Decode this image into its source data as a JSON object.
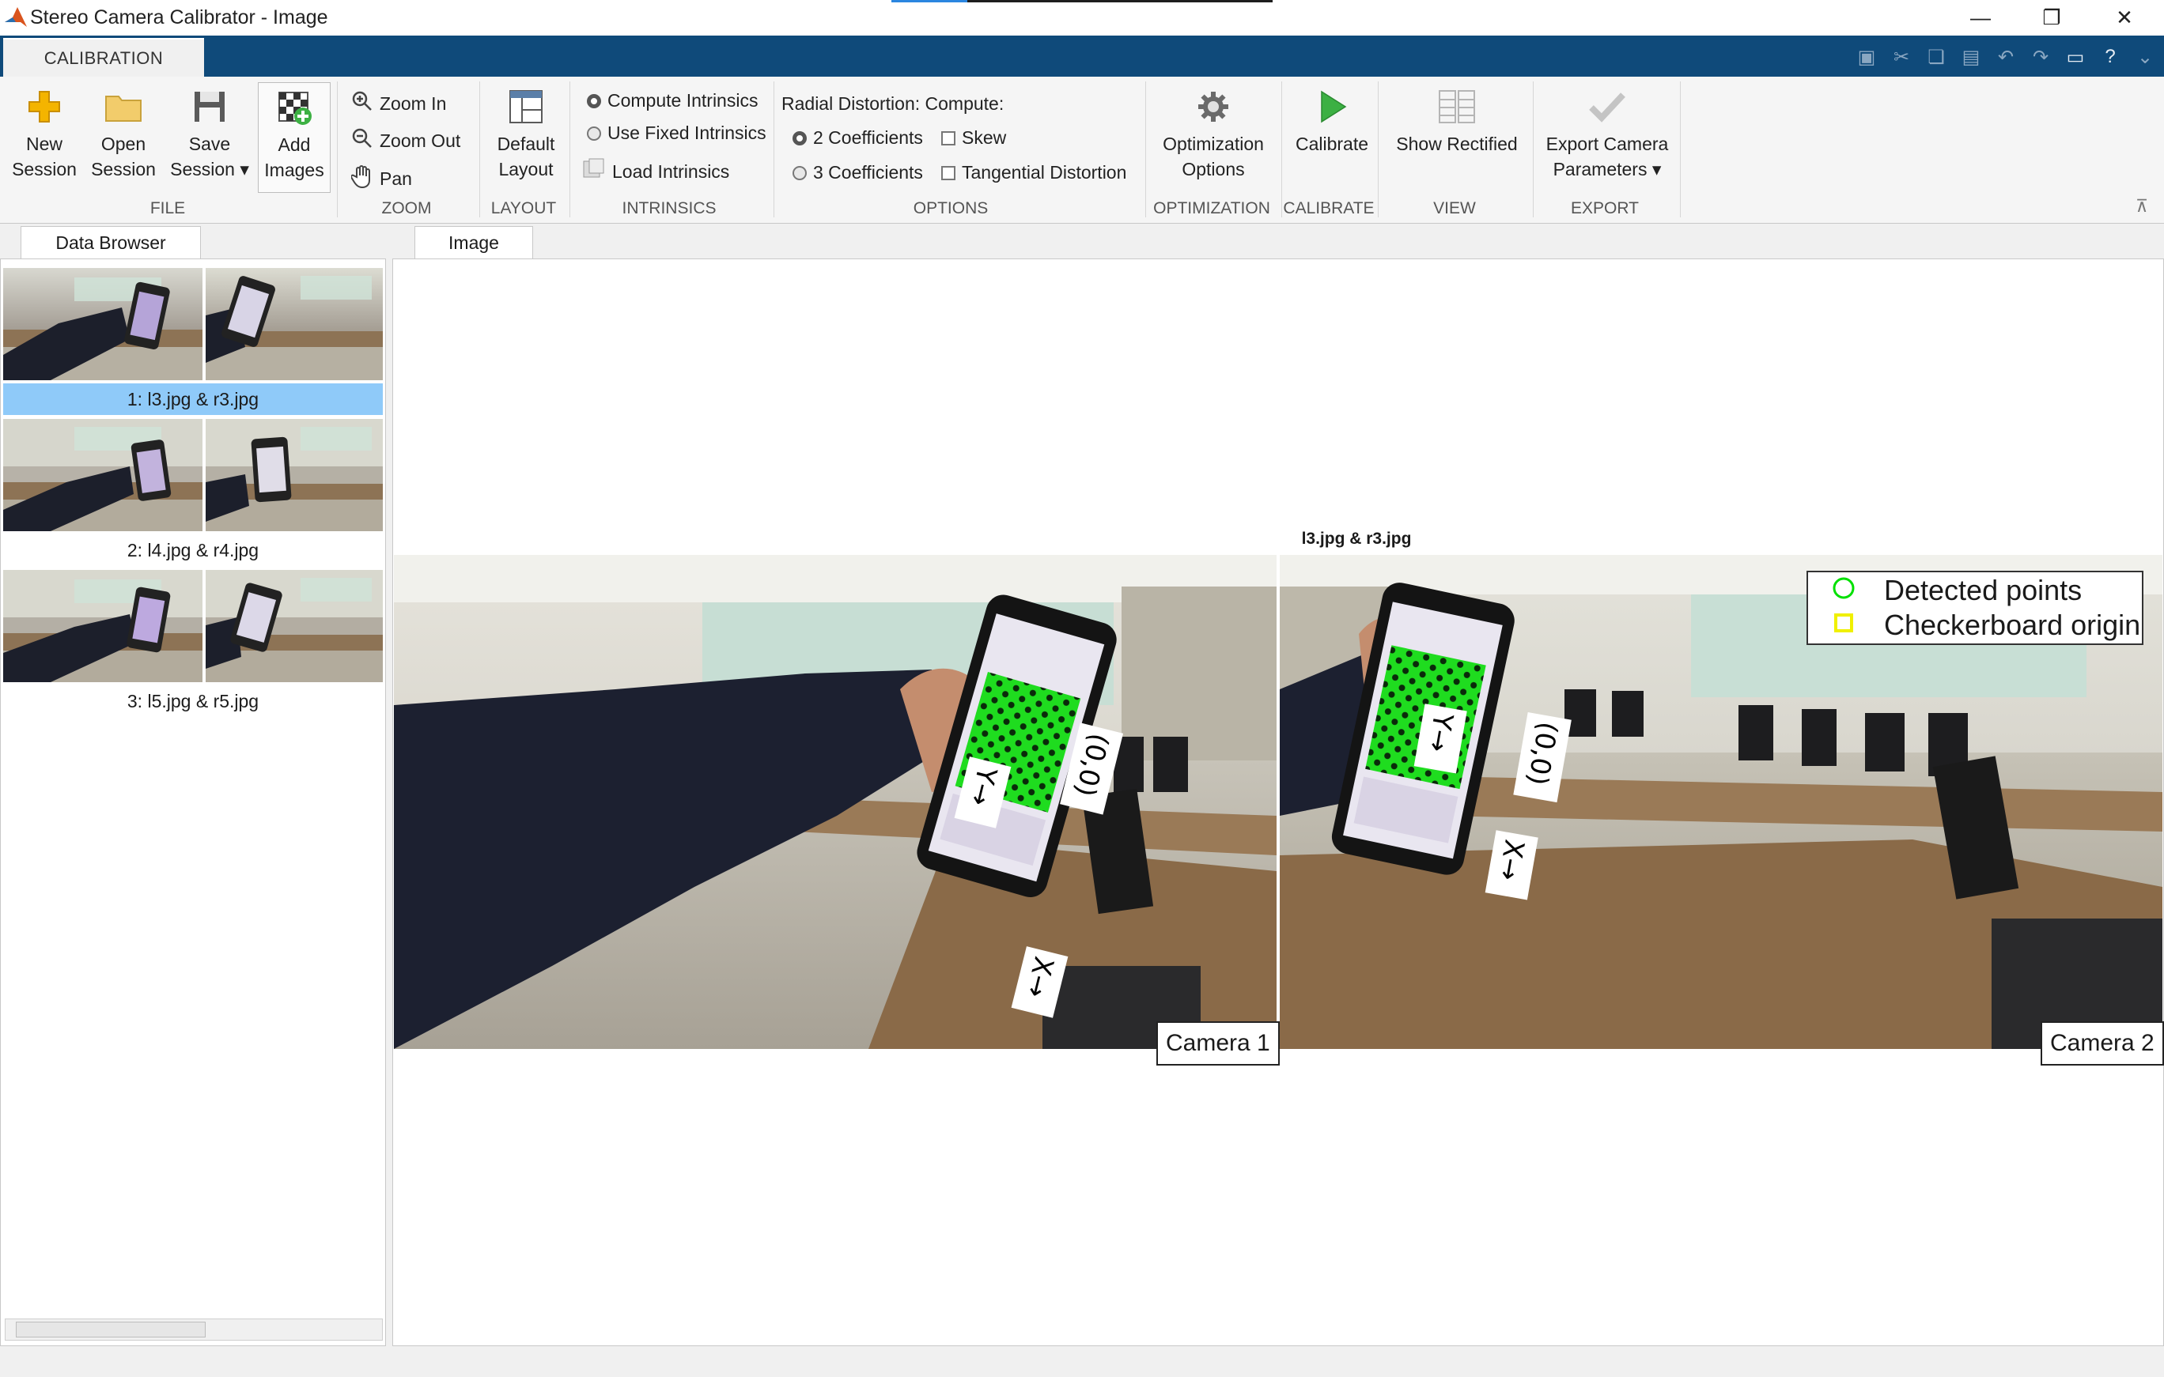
{
  "window": {
    "title": "Stereo Camera Calibrator - Image",
    "controls": [
      "—",
      "❐",
      "✕"
    ]
  },
  "ribbon": {
    "tab": "CALIBRATION",
    "file": {
      "new_session": [
        "New",
        "Session"
      ],
      "open_session": [
        "Open",
        "Session"
      ],
      "save_session": [
        "Save",
        "Session"
      ],
      "add_images": [
        "Add",
        "Images"
      ],
      "label": "FILE"
    },
    "zoom": {
      "zoom_in": "Zoom In",
      "zoom_out": "Zoom Out",
      "pan": "Pan",
      "label": "ZOOM"
    },
    "layout": {
      "default_layout": [
        "Default",
        "Layout"
      ],
      "label": "LAYOUT"
    },
    "intrinsics": {
      "compute": "Compute Intrinsics",
      "use_fixed": "Use Fixed Intrinsics",
      "load": "Load Intrinsics",
      "label": "INTRINSICS"
    },
    "options": {
      "radial_title": "Radial Distortion: Compute:",
      "two_coeff": "2 Coefficients",
      "three_coeff": "3 Coefficients",
      "skew": "Skew",
      "tangential": "Tangential Distortion",
      "label": "OPTIONS"
    },
    "optimization": {
      "button": [
        "Optimization",
        "Options"
      ],
      "label": "OPTIMIZATION"
    },
    "calibrate": {
      "button": "Calibrate",
      "label": "CALIBRATE"
    },
    "view": {
      "button": "Show Rectified",
      "label": "VIEW"
    },
    "export": {
      "button": [
        "Export Camera",
        "Parameters"
      ],
      "label": "EXPORT"
    }
  },
  "data_browser": {
    "tab": "Data Browser",
    "items": [
      {
        "label": "1: l3.jpg & r3.jpg",
        "selected": true
      },
      {
        "label": "2: l4.jpg & r4.jpg",
        "selected": false
      },
      {
        "label": "3: l5.jpg & r5.jpg",
        "selected": false
      }
    ]
  },
  "image_view": {
    "tab": "Image",
    "title": "l3.jpg & r3.jpg",
    "camera1": "Camera 1",
    "camera2": "Camera 2",
    "board_x": "X→",
    "board_y": "Y→",
    "board_origin": "(0,0)",
    "legend": {
      "detected": "Detected points",
      "origin": "Checkerboard origin"
    }
  },
  "colors": {
    "accent": "#0f4a7a",
    "selection": "#8fcaf9",
    "detected": "#00ff00",
    "origin": "#ffff00",
    "calibrate_green": "#3cb043"
  }
}
